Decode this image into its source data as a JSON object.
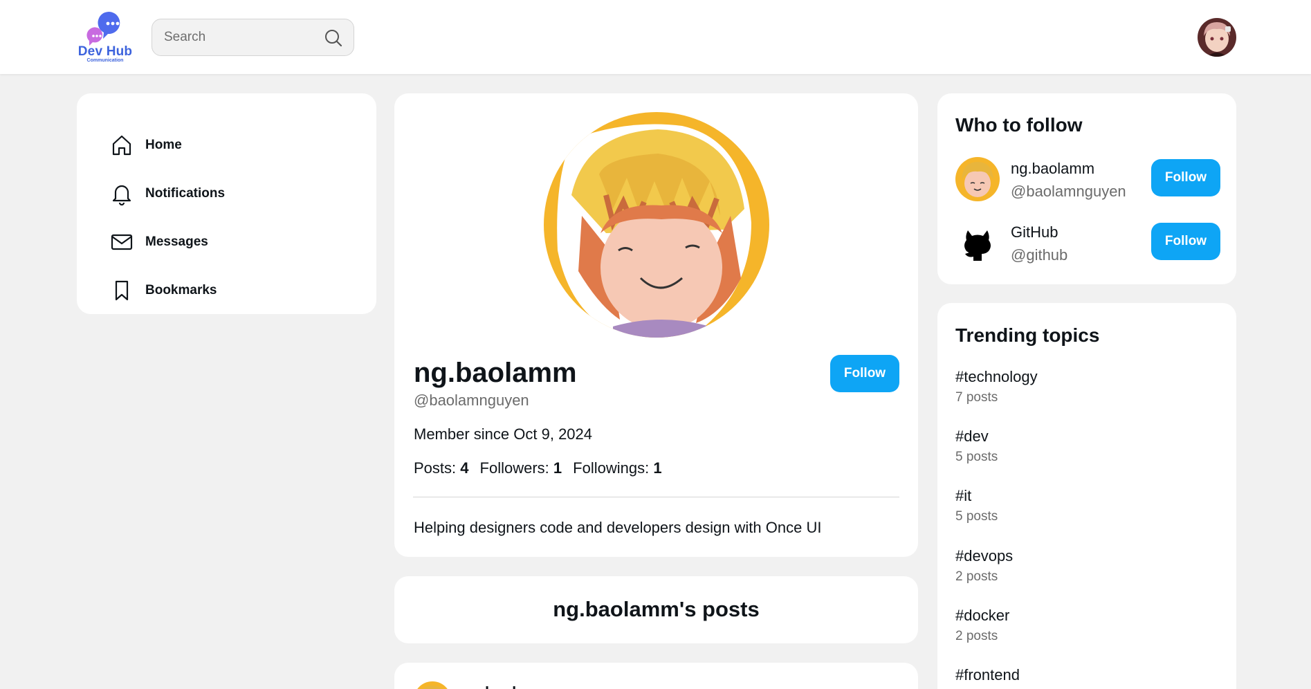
{
  "header": {
    "logo": {
      "title": "Dev Hub",
      "subtitle": "Communication"
    },
    "search": {
      "placeholder": "Search"
    }
  },
  "nav": {
    "items": [
      {
        "label": "Home",
        "icon": "home-icon"
      },
      {
        "label": "Notifications",
        "icon": "bell-icon"
      },
      {
        "label": "Messages",
        "icon": "mail-icon"
      },
      {
        "label": "Bookmarks",
        "icon": "bookmark-icon"
      }
    ]
  },
  "profile": {
    "name": "ng.baolamm",
    "handle": "@baolamnguyen",
    "follow_label": "Follow",
    "member_since": "Member since Oct 9, 2024",
    "stats": {
      "posts_label": "Posts:",
      "posts": "4",
      "followers_label": "Followers:",
      "followers": "1",
      "followings_label": "Followings:",
      "followings": "1"
    },
    "bio": "Helping designers code and developers design with Once UI"
  },
  "posts_section": {
    "title": "ng.baolamm's posts"
  },
  "post_preview": {
    "author": "ng.baolamm"
  },
  "who_to_follow": {
    "title": "Who to follow",
    "users": [
      {
        "name": "ng.baolamm",
        "handle": "@baolamnguyen",
        "follow_label": "Follow"
      },
      {
        "name": "GitHub",
        "handle": "@github",
        "follow_label": "Follow"
      }
    ]
  },
  "trending": {
    "title": "Trending topics",
    "topics": [
      {
        "tag": "#technology",
        "count": "7 posts"
      },
      {
        "tag": "#dev",
        "count": "5 posts"
      },
      {
        "tag": "#it",
        "count": "5 posts"
      },
      {
        "tag": "#devops",
        "count": "2 posts"
      },
      {
        "tag": "#docker",
        "count": "2 posts"
      },
      {
        "tag": "#frontend",
        "count": ""
      }
    ]
  },
  "colors": {
    "accent": "#0ea5f5",
    "brand": "#3d63dd",
    "background": "#f1f1f1",
    "card": "#ffffff",
    "muted_text": "#6b6b6b"
  }
}
